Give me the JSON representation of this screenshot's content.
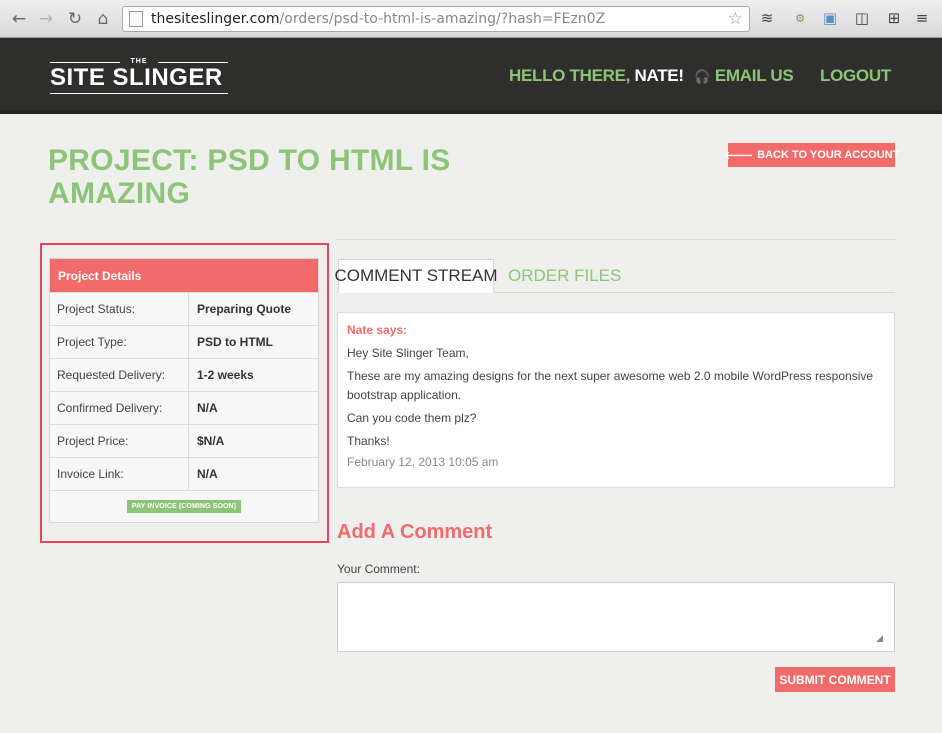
{
  "browser": {
    "url_host": "thesiteslinger.com",
    "url_path": "/orders/psd-to-html-is-amazing/?hash=FEzn0Z"
  },
  "header": {
    "logo_top": "THE",
    "logo_main": "SITE SLINGER",
    "greeting": "HELLO THERE,",
    "user_name": "NATE!",
    "email_label": "EMAIL US",
    "logout_label": "LOGOUT"
  },
  "page": {
    "title": "PROJECT: PSD TO HTML IS AMAZING",
    "back_button": "BACK TO YOUR ACCOUNT"
  },
  "project_details": {
    "heading": "Project Details",
    "rows": [
      {
        "label": "Project Status:",
        "value": "Preparing Quote"
      },
      {
        "label": "Project Type:",
        "value": "PSD to HTML"
      },
      {
        "label": "Requested Delivery:",
        "value": "1-2 weeks"
      },
      {
        "label": "Confirmed Delivery:",
        "value": "N/A"
      },
      {
        "label": "Project Price:",
        "value": "$N/A"
      },
      {
        "label": "Invoice Link:",
        "value": "N/A"
      }
    ],
    "pay_button": "PAY INVOICE (COMING SOON)"
  },
  "tabs": [
    {
      "label": "COMMENT STREAM",
      "active": true
    },
    {
      "label": "ORDER FILES",
      "active": false
    }
  ],
  "comment": {
    "author": "Nate says:",
    "lines": [
      "Hey Site Slinger Team,",
      "These are my amazing designs for the next super awesome web 2.0 mobile WordPress responsive bootstrap application.",
      "Can you code them plz?",
      "Thanks!"
    ],
    "timestamp": "February 12, 2013 10:05 am"
  },
  "add_comment": {
    "title": "Add A Comment",
    "field_label": "Your Comment:",
    "value": "",
    "submit_label": "SUBMIT COMMENT"
  },
  "colors": {
    "accent_green": "#8cc577",
    "accent_red": "#f26a6a",
    "header_bg": "#2e2e2d",
    "highlight_border": "#ea4556"
  }
}
